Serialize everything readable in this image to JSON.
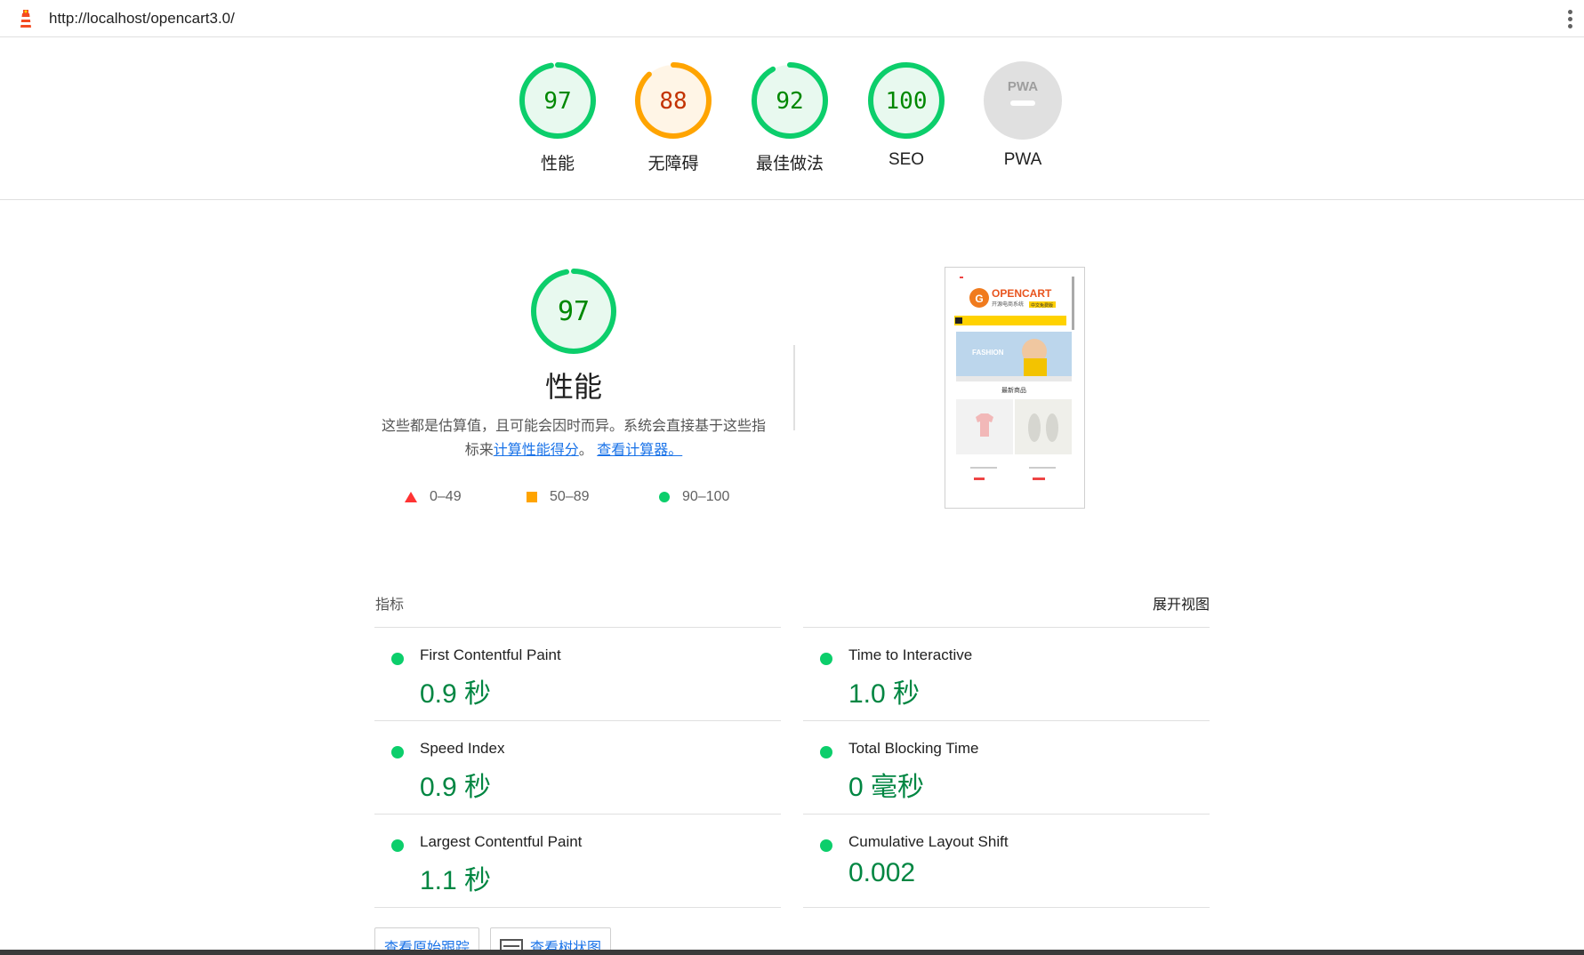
{
  "browser": {
    "url": "http://localhost/opencart3.0/"
  },
  "categories": [
    {
      "label": "性能",
      "score": "97",
      "value": 0.97,
      "status": "pass"
    },
    {
      "label": "无障碍",
      "score": "88",
      "value": 0.88,
      "status": "average"
    },
    {
      "label": "最佳做法",
      "score": "92",
      "value": 0.92,
      "status": "pass"
    },
    {
      "label": "SEO",
      "score": "100",
      "value": 1.0,
      "status": "pass"
    },
    {
      "label": "PWA",
      "score": "PWA",
      "value": null,
      "status": "na"
    }
  ],
  "performance": {
    "score": "97",
    "value": 0.97,
    "title": "性能",
    "desc_line1": "这些都是估算值，且可能会因时而异。系统会直接基于这些指",
    "desc_prefix": "标来",
    "link_calc_score": "计算性能得分",
    "desc_mid": "。",
    "link_calculator": "查看计算器。"
  },
  "legend": [
    {
      "range": "0–49",
      "shape": "triangle",
      "color": "#ff3333"
    },
    {
      "range": "50–89",
      "shape": "square",
      "color": "#ffa400"
    },
    {
      "range": "90–100",
      "shape": "circle",
      "color": "#0cce6b"
    }
  ],
  "screenshot": {
    "brand": "OPENCART",
    "subtitle": "开源电商系统",
    "badge": "中文免费版",
    "banner_text": "FASHION",
    "section_title": "最新商品"
  },
  "metrics": {
    "heading": "指标",
    "expand_label": "展开视图",
    "items": [
      {
        "name": "First Contentful Paint",
        "value": "0.9 秒"
      },
      {
        "name": "Time to Interactive",
        "value": "1.0 秒"
      },
      {
        "name": "Speed Index",
        "value": "0.9 秒"
      },
      {
        "name": "Total Blocking Time",
        "value": "0 毫秒"
      },
      {
        "name": "Largest Contentful Paint",
        "value": "1.1 秒"
      },
      {
        "name": "Cumulative Layout Shift",
        "value": "0.002"
      }
    ]
  },
  "buttons": {
    "view_trace": "查看原始跟踪",
    "view_treemap": "查看树状图"
  },
  "colors": {
    "pass": "#0cce6b",
    "pass_text": "#008800",
    "average": "#ffa400",
    "average_text": "#c33300",
    "na": "#e0e0e0"
  }
}
